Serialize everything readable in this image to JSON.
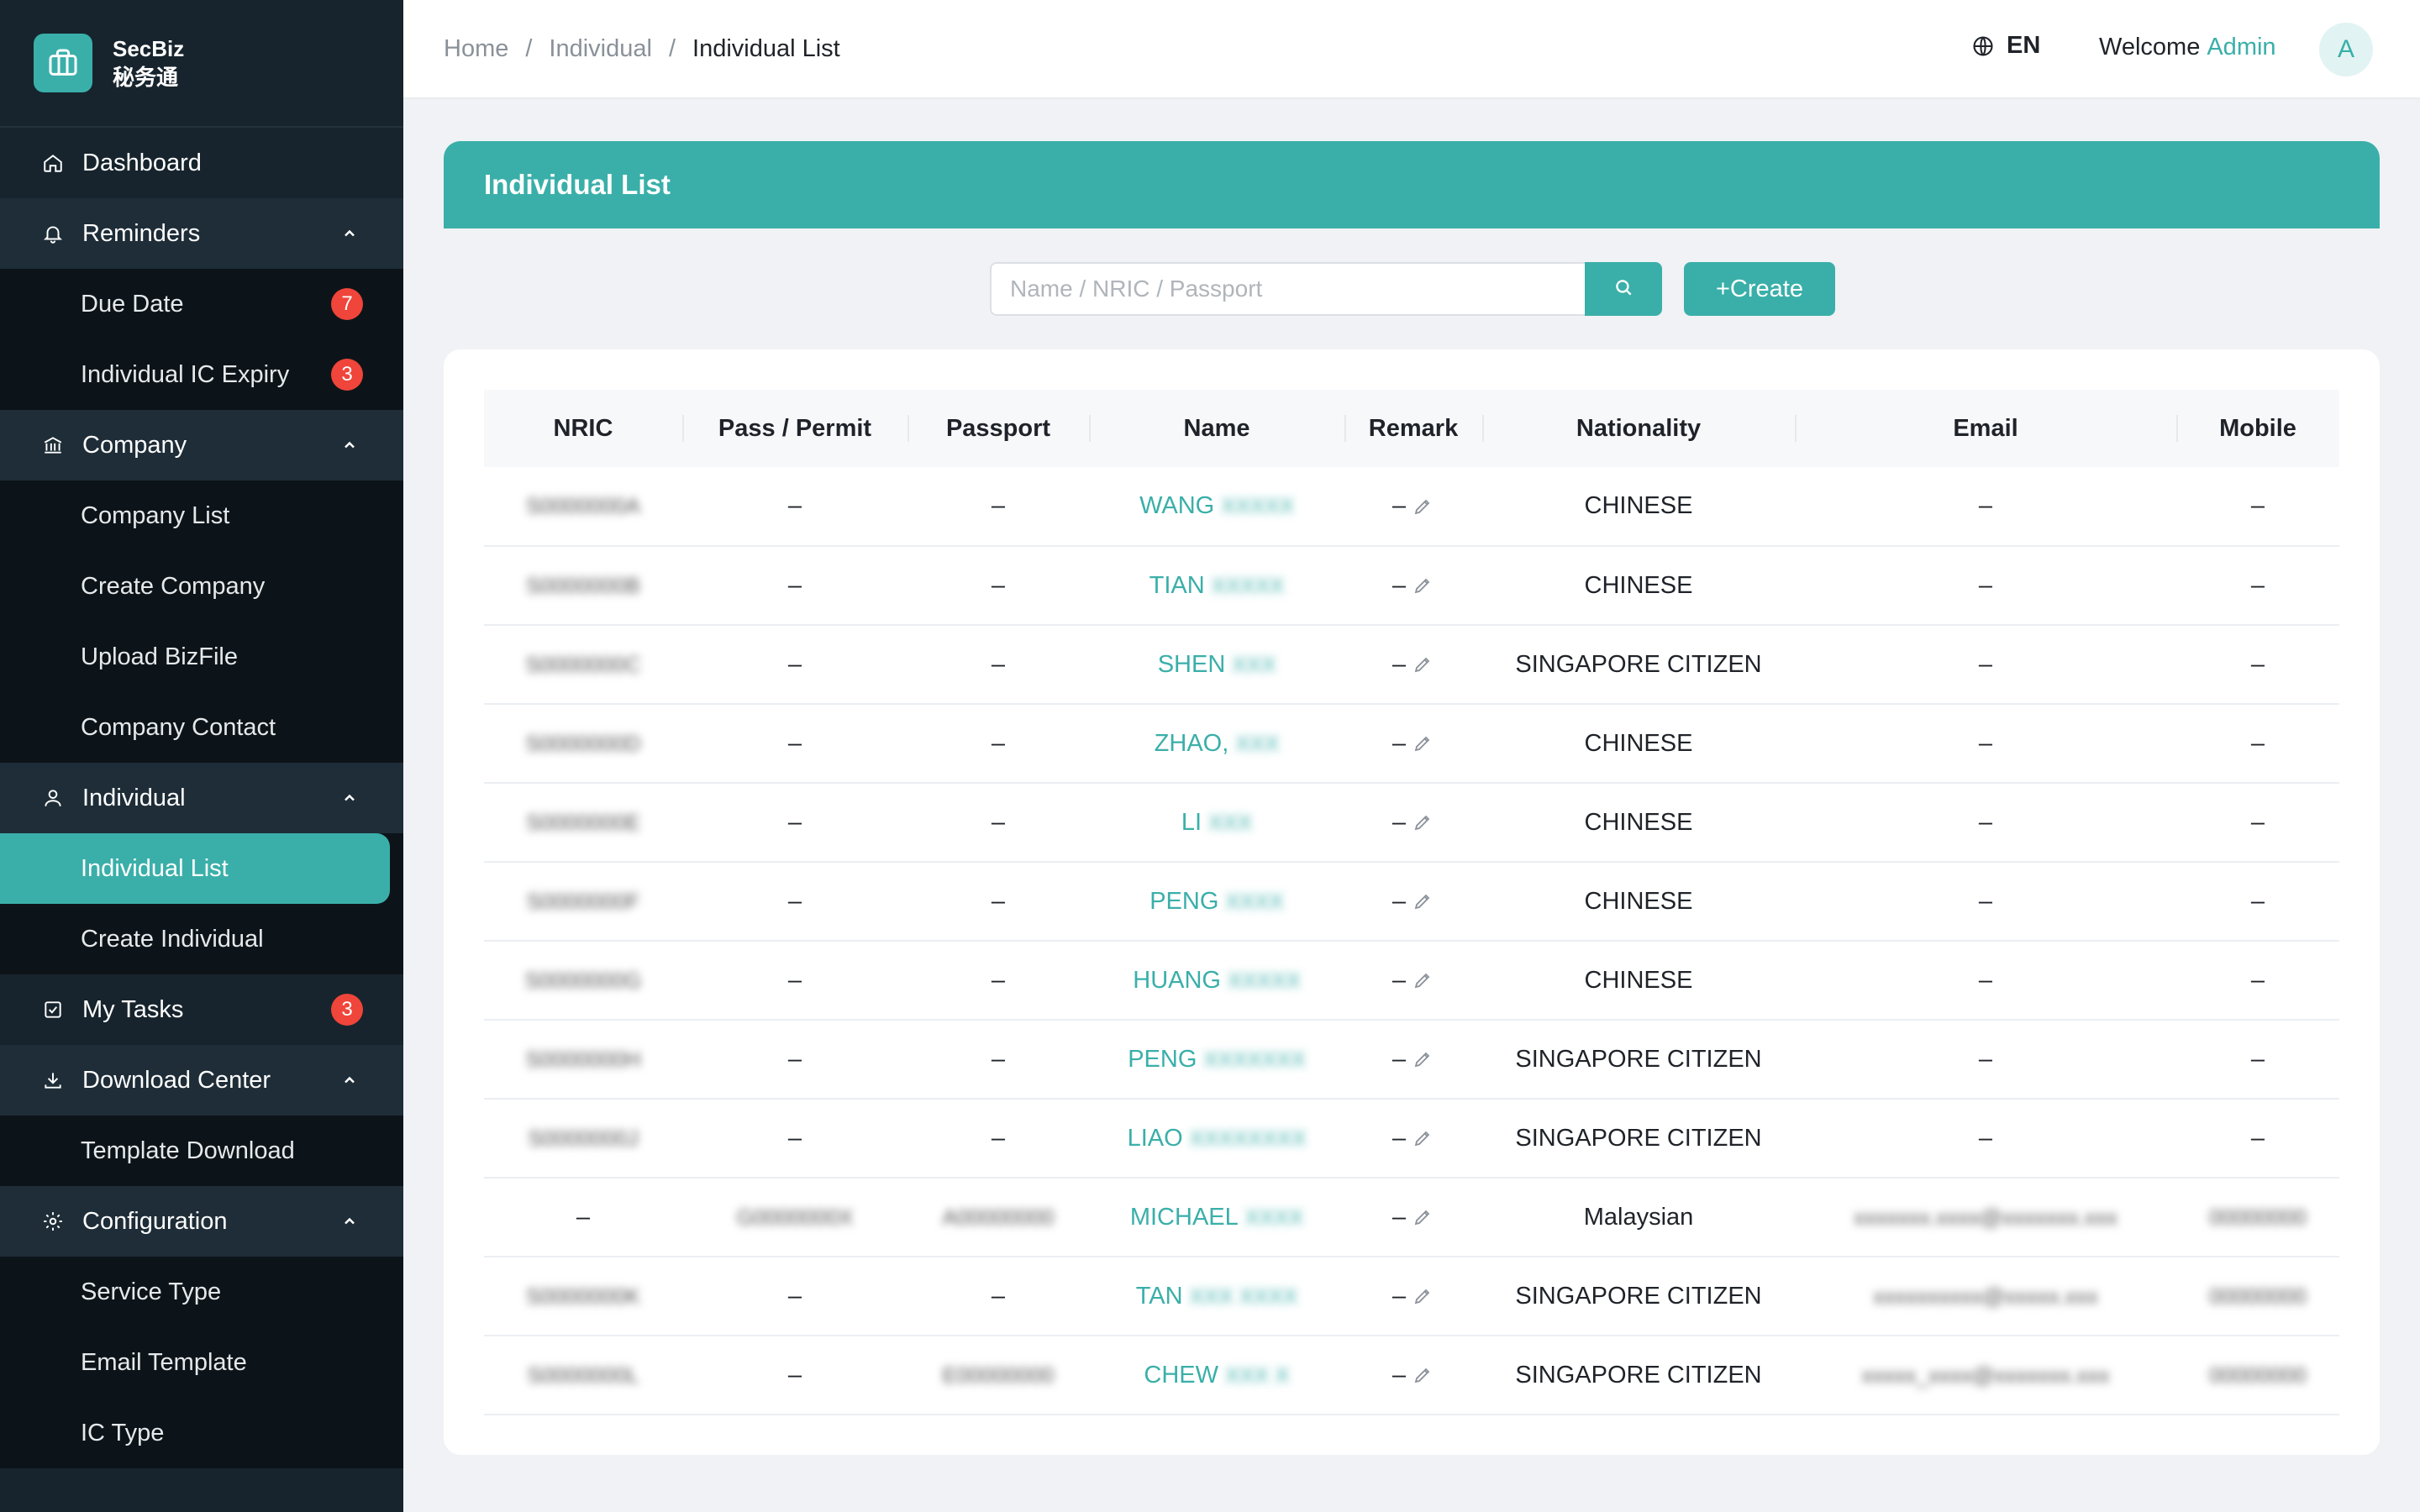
{
  "brand": {
    "name_en": "SecBiz",
    "name_cn": "秘务通"
  },
  "sidebar": {
    "dashboard": "Dashboard",
    "reminders": {
      "label": "Reminders",
      "items": [
        {
          "label": "Due Date",
          "badge": "7"
        },
        {
          "label": "Individual IC Expiry",
          "badge": "3"
        }
      ]
    },
    "company": {
      "label": "Company",
      "items": [
        "Company List",
        "Create Company",
        "Upload BizFile",
        "Company Contact"
      ]
    },
    "individual": {
      "label": "Individual",
      "items": [
        "Individual List",
        "Create Individual"
      ]
    },
    "my_tasks": {
      "label": "My Tasks",
      "badge": "3"
    },
    "download_center": {
      "label": "Download Center",
      "items": [
        "Template Download"
      ]
    },
    "configuration": {
      "label": "Configuration",
      "items": [
        "Service Type",
        "Email Template",
        "IC Type"
      ]
    }
  },
  "header": {
    "breadcrumb": [
      "Home",
      "Individual",
      "Individual List"
    ],
    "breadcrumb_sep": "/",
    "language": "EN",
    "welcome": "Welcome",
    "user": "Admin",
    "avatar_initial": "A"
  },
  "page": {
    "title": "Individual List",
    "search_placeholder": "Name / NRIC / Passport",
    "create_label": "+Create"
  },
  "colors": {
    "accent": "#3aafa9",
    "sidebar_bg": "#17242d",
    "submenu_bg": "#0d1419",
    "badge": "#f0453a"
  },
  "table": {
    "columns": [
      "NRIC",
      "Pass / Permit",
      "Passport",
      "Name",
      "Remark",
      "Nationality",
      "Email",
      "Mobile"
    ],
    "rows": [
      {
        "nric": "S0000000A",
        "pass": "–",
        "passport": "–",
        "name": "WANG",
        "name_rest": "XXXXX",
        "remark": "–",
        "nationality": "CHINESE",
        "email": "–",
        "mobile": "–"
      },
      {
        "nric": "S0000000B",
        "pass": "–",
        "passport": "–",
        "name": "TIAN",
        "name_rest": "XXXXX",
        "remark": "–",
        "nationality": "CHINESE",
        "email": "–",
        "mobile": "–"
      },
      {
        "nric": "S0000000C",
        "pass": "–",
        "passport": "–",
        "name": "SHEN",
        "name_rest": "XXX",
        "remark": "–",
        "nationality": "SINGAPORE CITIZEN",
        "email": "–",
        "mobile": "–"
      },
      {
        "nric": "S0000000D",
        "pass": "–",
        "passport": "–",
        "name": "ZHAO,",
        "name_rest": "XXX",
        "remark": "–",
        "nationality": "CHINESE",
        "email": "–",
        "mobile": "–"
      },
      {
        "nric": "S0000000E",
        "pass": "–",
        "passport": "–",
        "name": "LI",
        "name_rest": "XXX",
        "remark": "–",
        "nationality": "CHINESE",
        "email": "–",
        "mobile": "–"
      },
      {
        "nric": "S0000000F",
        "pass": "–",
        "passport": "–",
        "name": "PENG",
        "name_rest": "XXXX",
        "remark": "–",
        "nationality": "CHINESE",
        "email": "–",
        "mobile": "–"
      },
      {
        "nric": "S0000000G",
        "pass": "–",
        "passport": "–",
        "name": "HUANG",
        "name_rest": "XXXXX",
        "remark": "–",
        "nationality": "CHINESE",
        "email": "–",
        "mobile": "–"
      },
      {
        "nric": "S0000000H",
        "pass": "–",
        "passport": "–",
        "name": "PENG",
        "name_rest": "XXXXXXX",
        "remark": "–",
        "nationality": "SINGAPORE CITIZEN",
        "email": "–",
        "mobile": "–"
      },
      {
        "nric": "S0000000J",
        "pass": "–",
        "passport": "–",
        "name": "LIAO",
        "name_rest": "XXXXXXXX",
        "remark": "–",
        "nationality": "SINGAPORE CITIZEN",
        "email": "–",
        "mobile": "–"
      },
      {
        "nric": "–",
        "pass": "G0000000X",
        "passport": "A00000000",
        "name": "MICHAEL",
        "name_rest": "XXXX",
        "remark": "–",
        "nationality": "Malaysian",
        "email": "xxxxxxx.xxxx@xxxxxxx.xxx",
        "mobile": "00000000"
      },
      {
        "nric": "S0000000K",
        "pass": "–",
        "passport": "–",
        "name": "TAN",
        "name_rest": "XXX XXXX",
        "remark": "–",
        "nationality": "SINGAPORE CITIZEN",
        "email": "xxxxxxxxxx@xxxxx.xxx",
        "mobile": "00000000"
      },
      {
        "nric": "S0000000L",
        "pass": "–",
        "passport": "E00000000",
        "name": "CHEW",
        "name_rest": "XXX X",
        "remark": "–",
        "nationality": "SINGAPORE CITIZEN",
        "email": "xxxxx_xxxx@xxxxxxx.xxx",
        "mobile": "00000000"
      }
    ]
  }
}
